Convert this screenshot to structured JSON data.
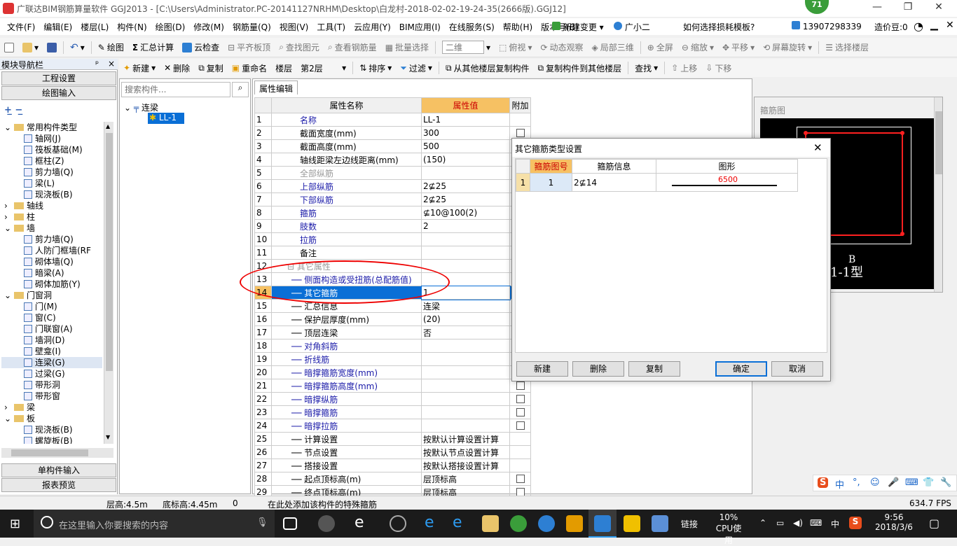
{
  "window": {
    "title": "广联达BIM钢筋算量软件 GGJ2013 - [C:\\Users\\Administrator.PC-20141127NRHM\\Desktop\\白龙村-2018-02-02-19-24-35(2666版).GGJ12]",
    "badge": "71",
    "min_glyph": "—",
    "max_glyph": "❐",
    "close_glyph": "✕"
  },
  "menubar": {
    "items": [
      "文件(F)",
      "编辑(E)",
      "楼层(L)",
      "构件(N)",
      "绘图(D)",
      "修改(M)",
      "钢筋量(Q)",
      "视图(V)",
      "工具(T)",
      "云应用(Y)",
      "BIM应用(I)",
      "在线服务(S)",
      "帮助(H)",
      "版本号(B)"
    ],
    "new_change": "新建变更",
    "assistant": "广小二",
    "help_question": "如何选择损耗模板?",
    "phone": "13907298339",
    "price_beans": "造价豆:0"
  },
  "toolbar1": {
    "draw": "绘图",
    "sum_calc": "汇总计算",
    "cloud_check": "云检查",
    "align_slab": "平齐板顶",
    "find_elem": "查找图元",
    "view_rebar": "查看钢筋量",
    "batch_select": "批量选择",
    "view_mode": "二维",
    "top_view": "俯视",
    "dynamic_view": "动态观察",
    "local_3d": "局部三维",
    "fullscreen": "全屏",
    "zoom": "缩放",
    "pan": "平移",
    "rotate": "屏幕旋转",
    "select_floor": "选择楼层"
  },
  "toolbar2": {
    "new": "新建",
    "delete": "删除",
    "copy": "复制",
    "rename": "重命名",
    "floor_label": "楼层",
    "floor_value": "第2层",
    "sort": "排序",
    "filter": "过滤",
    "copy_from_floor": "从其他楼层复制构件",
    "copy_to_floor": "复制构件到其他楼层",
    "find": "查找",
    "move_up": "上移",
    "move_down": "下移"
  },
  "nav": {
    "header": "模块导航栏",
    "pin": "ᵖ",
    "close": "×",
    "project_settings": "工程设置",
    "drawing_input": "绘图输入",
    "single_input": "单构件输入",
    "report_preview": "报表预览",
    "tree": [
      {
        "level": 0,
        "exp": "⌄",
        "type": "folder",
        "label": "常用构件类型"
      },
      {
        "level": 1,
        "type": "item",
        "label": "轴网(J)"
      },
      {
        "level": 1,
        "type": "item",
        "label": "筏板基础(M)"
      },
      {
        "level": 1,
        "type": "item",
        "label": "框柱(Z)"
      },
      {
        "level": 1,
        "type": "item",
        "label": "剪力墙(Q)"
      },
      {
        "level": 1,
        "type": "item",
        "label": "梁(L)"
      },
      {
        "level": 1,
        "type": "item",
        "label": "现浇板(B)"
      },
      {
        "level": 0,
        "exp": "›",
        "type": "folder",
        "label": "轴线"
      },
      {
        "level": 0,
        "exp": "›",
        "type": "folder",
        "label": "柱"
      },
      {
        "level": 0,
        "exp": "⌄",
        "type": "folder",
        "label": "墙"
      },
      {
        "level": 1,
        "type": "item",
        "label": "剪力墙(Q)"
      },
      {
        "level": 1,
        "type": "item",
        "label": "人防门框墙(RF"
      },
      {
        "level": 1,
        "type": "item",
        "label": "砌体墙(Q)"
      },
      {
        "level": 1,
        "type": "item",
        "label": "暗梁(A)"
      },
      {
        "level": 1,
        "type": "item",
        "label": "砌体加筋(Y)"
      },
      {
        "level": 0,
        "exp": "⌄",
        "type": "folder",
        "label": "门窗洞"
      },
      {
        "level": 1,
        "type": "item",
        "label": "门(M)"
      },
      {
        "level": 1,
        "type": "item",
        "label": "窗(C)"
      },
      {
        "level": 1,
        "type": "item",
        "label": "门联窗(A)"
      },
      {
        "level": 1,
        "type": "item",
        "label": "墙洞(D)"
      },
      {
        "level": 1,
        "type": "item",
        "label": "壁龛(I)"
      },
      {
        "level": 1,
        "type": "item",
        "label": "连梁(G)"
      },
      {
        "level": 1,
        "type": "item",
        "label": "过梁(G)"
      },
      {
        "level": 1,
        "type": "item",
        "label": "带形洞"
      },
      {
        "level": 1,
        "type": "item",
        "label": "带形窗"
      },
      {
        "level": 0,
        "exp": "›",
        "type": "folder",
        "label": "梁"
      },
      {
        "level": 0,
        "exp": "⌄",
        "type": "folder",
        "label": "板"
      },
      {
        "level": 1,
        "type": "item",
        "label": "现浇板(B)"
      },
      {
        "level": 1,
        "type": "item",
        "label": "螺旋板(B)"
      }
    ]
  },
  "component_list": {
    "search_placeholder": "搜索构件...",
    "root": "连梁",
    "child": "LL-1"
  },
  "properties": {
    "tab": "属性编辑",
    "col_name": "属性名称",
    "col_value": "属性值",
    "col_extra": "附加",
    "rows": [
      {
        "n": "1",
        "name": "名称",
        "value": "LL-1",
        "style": "blue",
        "cb": false
      },
      {
        "n": "2",
        "name": "截面宽度(mm)",
        "value": "300",
        "style": "",
        "cb": true
      },
      {
        "n": "3",
        "name": "截面高度(mm)",
        "value": "500",
        "style": "",
        "cb": true
      },
      {
        "n": "4",
        "name": "轴线距梁左边线距离(mm)",
        "value": "(150)",
        "style": "",
        "cb": true
      },
      {
        "n": "5",
        "name": "全部纵筋",
        "value": "",
        "style": "dim",
        "cb": true
      },
      {
        "n": "6",
        "name": "上部纵筋",
        "value": "2⊈25",
        "style": "blue",
        "cb": true
      },
      {
        "n": "7",
        "name": "下部纵筋",
        "value": "2⊈25",
        "style": "blue",
        "cb": true
      },
      {
        "n": "8",
        "name": "箍筋",
        "value": "⊈10@100(2)",
        "style": "blue",
        "cb": true
      },
      {
        "n": "9",
        "name": "肢数",
        "value": "2",
        "style": "blue",
        "cb": false
      },
      {
        "n": "10",
        "name": "拉筋",
        "value": "",
        "style": "blue",
        "cb": true
      },
      {
        "n": "11",
        "name": "备注",
        "value": "",
        "style": "",
        "cb": true
      },
      {
        "n": "12",
        "name": "⊟ 其它属性",
        "value": "",
        "style": "dim",
        "cb": false
      },
      {
        "n": "13",
        "name": "── 侧面构造或受扭筋(总配筋值)",
        "value": "",
        "style": "blue",
        "cb": true
      },
      {
        "n": "14",
        "name": "── 其它箍筋",
        "value": "1",
        "style": "sel",
        "cb": false
      },
      {
        "n": "15",
        "name": "── 汇总信息",
        "value": "连梁",
        "style": "",
        "cb": true
      },
      {
        "n": "16",
        "name": "── 保护层厚度(mm)",
        "value": "(20)",
        "style": "",
        "cb": true
      },
      {
        "n": "17",
        "name": "── 顶层连梁",
        "value": "否",
        "style": "",
        "cb": true
      },
      {
        "n": "18",
        "name": "── 对角斜筋",
        "value": "",
        "style": "blue",
        "cb": true
      },
      {
        "n": "19",
        "name": "── 折线筋",
        "value": "",
        "style": "blue",
        "cb": true
      },
      {
        "n": "20",
        "name": "── 暗撑箍筋宽度(mm)",
        "value": "",
        "style": "blue",
        "cb": true
      },
      {
        "n": "21",
        "name": "── 暗撑箍筋高度(mm)",
        "value": "",
        "style": "blue",
        "cb": true
      },
      {
        "n": "22",
        "name": "── 暗撑纵筋",
        "value": "",
        "style": "blue",
        "cb": true
      },
      {
        "n": "23",
        "name": "── 暗撑箍筋",
        "value": "",
        "style": "blue",
        "cb": true
      },
      {
        "n": "24",
        "name": "── 暗撑拉筋",
        "value": "",
        "style": "blue",
        "cb": true
      },
      {
        "n": "25",
        "name": "── 计算设置",
        "value": "按默认计算设置计算",
        "style": "",
        "cb": false
      },
      {
        "n": "26",
        "name": "── 节点设置",
        "value": "按默认节点设置计算",
        "style": "",
        "cb": false
      },
      {
        "n": "27",
        "name": "── 搭接设置",
        "value": "按默认搭接设置计算",
        "style": "",
        "cb": false
      },
      {
        "n": "28",
        "name": "── 起点顶标高(m)",
        "value": "层顶标高",
        "style": "",
        "cb": true
      },
      {
        "n": "29",
        "name": "── 终点顶标高(m)",
        "value": "层顶标高",
        "style": "",
        "cb": true
      }
    ]
  },
  "preview": {
    "title": "箍筋图",
    "label_b": "B",
    "label_type": "1-1型"
  },
  "dialog": {
    "title": "其它箍筋类型设置",
    "close": "✕",
    "col_no": "箍筋图号",
    "col_info": "箍筋信息",
    "col_shape": "图形",
    "row": {
      "idx": "1",
      "no": "1",
      "info": "2⊈14",
      "length": "6500"
    },
    "btn_new": "新建",
    "btn_delete": "删除",
    "btn_copy": "复制",
    "btn_ok": "确定",
    "btn_cancel": "取消"
  },
  "status": {
    "floor_height": "层高:4.5m",
    "base_elev": "底标高:4.45m",
    "zero": "0",
    "hint": "在此处添加该构件的特殊箍筋",
    "fps": "634.7 FPS"
  },
  "ime": {
    "items": [
      "S",
      "中",
      "°,",
      "☺",
      "🎤",
      "⌨",
      "👕",
      "🔧"
    ]
  },
  "taskbar": {
    "search_placeholder": "在这里输入你要搜索的内容",
    "link": "链接",
    "cpu_pct": "10%",
    "cpu_label": "CPU使用",
    "lang": "中",
    "time": "9:56",
    "date": "2018/3/6",
    "colors": {
      "accent": "#0a6fd6",
      "ellipse": "#e00000",
      "rebar_red": "#ff2020"
    }
  }
}
